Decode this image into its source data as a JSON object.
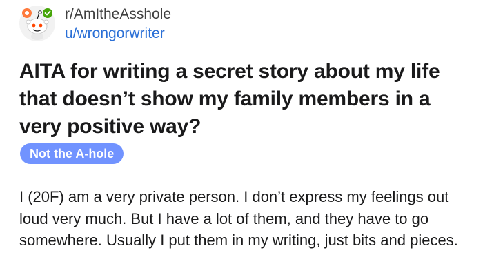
{
  "post": {
    "subreddit": "r/AmItheAsshole",
    "username": "u/wrongorwriter",
    "avatar_icon": "snoo-avatar-icon",
    "title": "AITA for writing a secret story about my life that doesn’t show my family members in a very positive way?",
    "flair": {
      "label": "Not the A-hole",
      "color": "#7193ff"
    },
    "body": "I (20F) am a very private person. I don’t express my feelings out loud very much. But I have a lot of them, and they have to go somewhere. Usually I put them in my writing, just bits and pieces."
  },
  "colors": {
    "username": "#2a6fd6",
    "text": "#1a1a1b",
    "subreddit": "#404040"
  }
}
